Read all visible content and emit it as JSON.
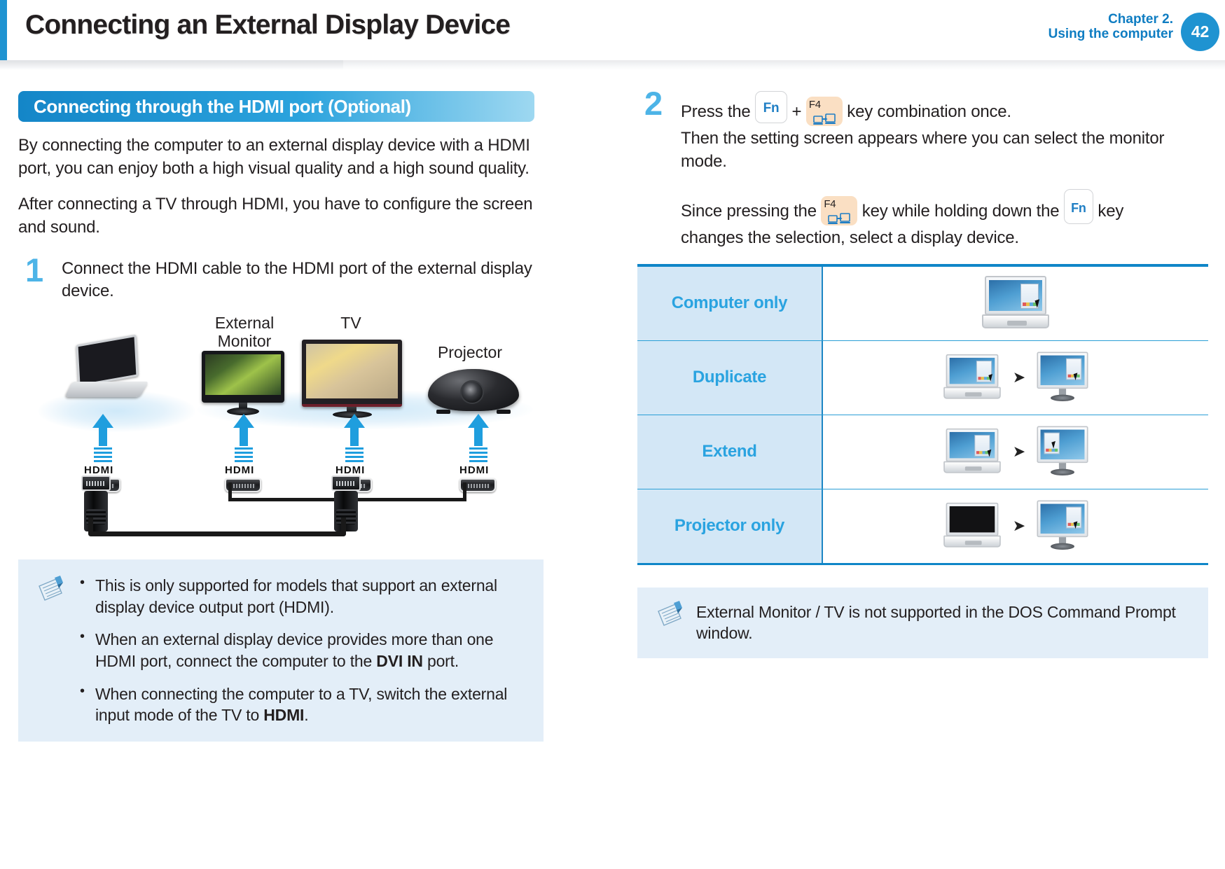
{
  "header": {
    "title": "Connecting an External Display Device",
    "chapter_line1": "Chapter 2.",
    "chapter_line2": "Using the computer",
    "page_number": "42",
    "accent_color": "#1f93d1"
  },
  "left_column": {
    "section_title": "Connecting through the HDMI port (Optional)",
    "paragraph_1": "By connecting the computer to an external display device with a HDMI port, you can enjoy both a high visual quality and a high sound quality.",
    "paragraph_2": "After connecting a TV through HDMI, you have to configure the screen and sound.",
    "step_1": {
      "number": "1",
      "text": "Connect the HDMI cable to the HDMI port of the external display device."
    },
    "diagram": {
      "labels": {
        "external_monitor": "External\nMonitor",
        "tv": "TV",
        "projector": "Projector"
      },
      "port_label": "HDMI"
    },
    "note": {
      "items": [
        "This is only supported for models that support an external display device output port (HDMI).",
        "When an external display device provides more than one HDMI port, connect the computer to the DVI IN port.",
        "When connecting the computer to a TV, switch the external input mode of the TV to HDMI."
      ],
      "bold_terms": [
        "DVI IN",
        "HDMI"
      ]
    }
  },
  "right_column": {
    "step_2": {
      "number": "2",
      "line_1_pre": "Press the",
      "key_fn": "Fn",
      "plus": "+",
      "key_f4_label": "F4",
      "line_1_post": "key combination once.",
      "line_2": "Then the setting screen appears where you can select the monitor mode.",
      "line_3_pre": "Since pressing the",
      "line_3_mid": "key while holding down the",
      "line_3_post": "key",
      "line_4": "changes the selection, select a display device."
    },
    "mode_table": {
      "rows": [
        {
          "label": "Computer only",
          "picture": "single-laptop"
        },
        {
          "label": "Duplicate",
          "picture": "laptop-arrow-monitor-same"
        },
        {
          "label": "Extend",
          "picture": "laptop-arrow-monitor-extended"
        },
        {
          "label": "Projector only",
          "picture": "laptop-off-arrow-monitor"
        }
      ],
      "label_color": "#2aa3e0",
      "label_cell_bg": "#d3e7f6",
      "rule_color": "#0f86c8"
    },
    "note": {
      "text": "External Monitor / TV is not supported in the DOS Command Prompt window."
    }
  }
}
